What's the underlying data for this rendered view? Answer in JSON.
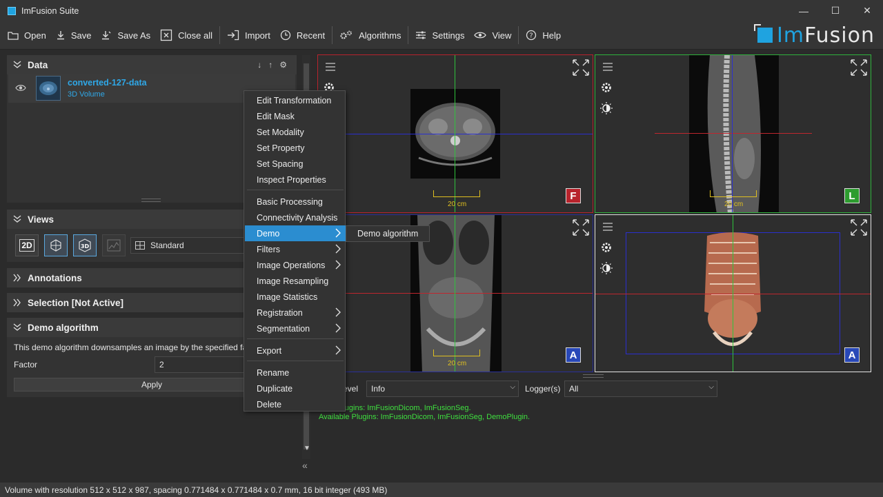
{
  "window": {
    "title": "ImFusion Suite",
    "minimize": "—",
    "maximize": "☐",
    "close": "✕"
  },
  "toolbar": {
    "open": "Open",
    "save": "Save",
    "save_as": "Save As",
    "close_all": "Close all",
    "import": "Import",
    "recent": "Recent",
    "algorithms": "Algorithms",
    "settings": "Settings",
    "view": "View",
    "help": "Help"
  },
  "logo": {
    "text_a": "Im",
    "text_b": "Fusion"
  },
  "data_panel": {
    "title": "Data",
    "item": {
      "name": "converted-127-data",
      "type": "3D Volume"
    }
  },
  "views_panel": {
    "title": "Views",
    "buttons": [
      "2D",
      "",
      "3D",
      ""
    ],
    "layout_value": "Standard"
  },
  "annotations_panel": {
    "title": "Annotations"
  },
  "selection_panel": {
    "title": "Selection [Not Active]"
  },
  "demo_panel": {
    "title": "Demo algorithm",
    "description": "This demo algorithm downsamples an image by the specified factor",
    "factor_label": "Factor",
    "factor_value": "2",
    "apply_label": "Apply"
  },
  "context_menu": {
    "items": [
      "Edit Transformation",
      "Edit Mask",
      "Set Modality",
      "Set Property",
      "Set Spacing",
      "Inspect Properties",
      "Basic Processing",
      "Connectivity Analysis",
      "Demo",
      "Filters",
      "Image Operations",
      "Image Resampling",
      "Image Statistics",
      "Registration",
      "Segmentation",
      "Export",
      "Rename",
      "Duplicate",
      "Delete"
    ],
    "submenu_item": "Demo algorithm"
  },
  "viewports": {
    "scale_label": "20 cm",
    "orient_tl": "F",
    "orient_tr": "L",
    "orient_bl": "A",
    "orient_br": "A",
    "colors": {
      "axial": "#b8232c",
      "sagittal": "#2fb33c",
      "coronal": "#2a2f9c"
    }
  },
  "log": {
    "level_label": "evel",
    "level_value": "Info",
    "logger_label": "Logger(s)",
    "logger_value": "All",
    "line1": "Plugins: ImFusionDicom, ImFusionSeg.",
    "line2": "Available Plugins: ImFusionDicom, ImFusionSeg, DemoPlugin."
  },
  "status": {
    "text": "Volume with resolution 512 x 512 x 987, spacing 0.771484 x 0.771484 x 0.7 mm, 16 bit integer (493 MB)"
  }
}
